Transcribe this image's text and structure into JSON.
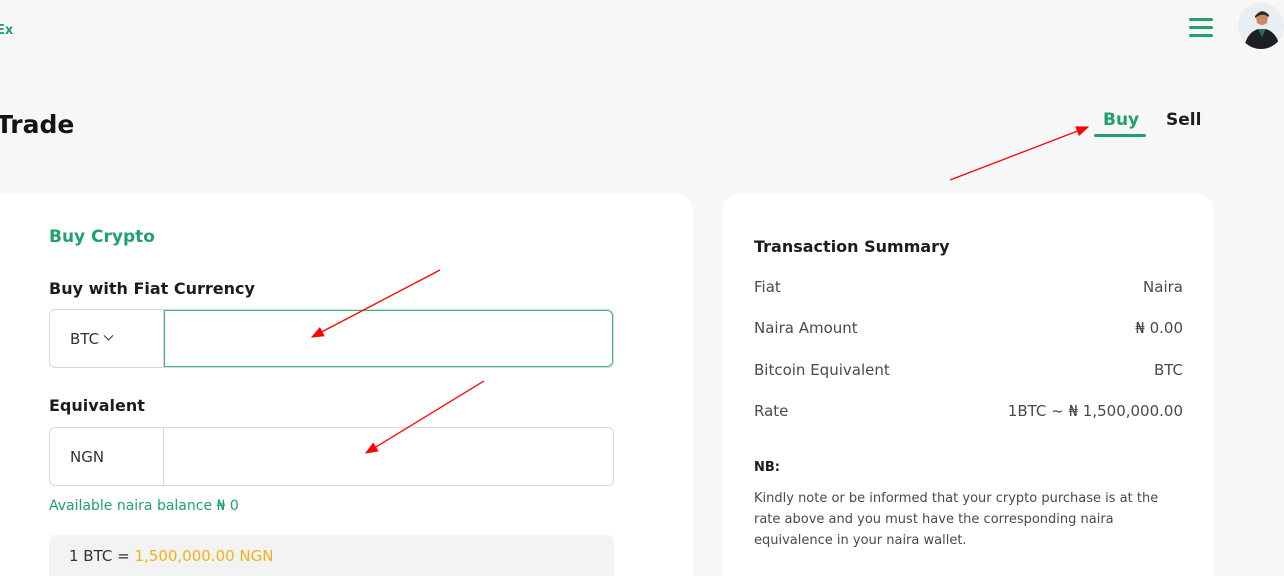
{
  "header": {
    "logo": "Ex"
  },
  "page": {
    "title": "Trade"
  },
  "tabs": [
    {
      "label": "Buy"
    },
    {
      "label": "Sell"
    }
  ],
  "buy_form": {
    "title": "Buy Crypto",
    "fiat_label": "Buy with Fiat Currency",
    "currency_select": "BTC",
    "fiat_amount": "",
    "equivalent_label": "Equivalent",
    "equivalent_prefix": "NGN",
    "equivalent_amount": "",
    "balance_text": "Available naira balance ₦ 0",
    "rate_prefix": "1 BTC = ",
    "rate_value": "1,500,000.00 NGN"
  },
  "summary": {
    "title": "Transaction Summary",
    "rows": [
      {
        "label": "Fiat",
        "value": "Naira"
      },
      {
        "label": "Naira Amount",
        "value": "₦ 0.00"
      },
      {
        "label": "Bitcoin Equivalent",
        "value": "BTC"
      },
      {
        "label": "Rate",
        "value": "1BTC ~ ₦ 1,500,000.00"
      }
    ],
    "nb_title": "NB:",
    "nb_text": "Kindly note or be informed that your crypto purchase is at the rate above and you must have the corresponding naira equivalence in your naira wallet."
  },
  "colors": {
    "accent": "#1fa16a",
    "highlight": "#f2b21c",
    "annotation": "#ff0000"
  },
  "icons": {
    "menu": "hamburger-menu-icon",
    "profile": "avatar"
  }
}
